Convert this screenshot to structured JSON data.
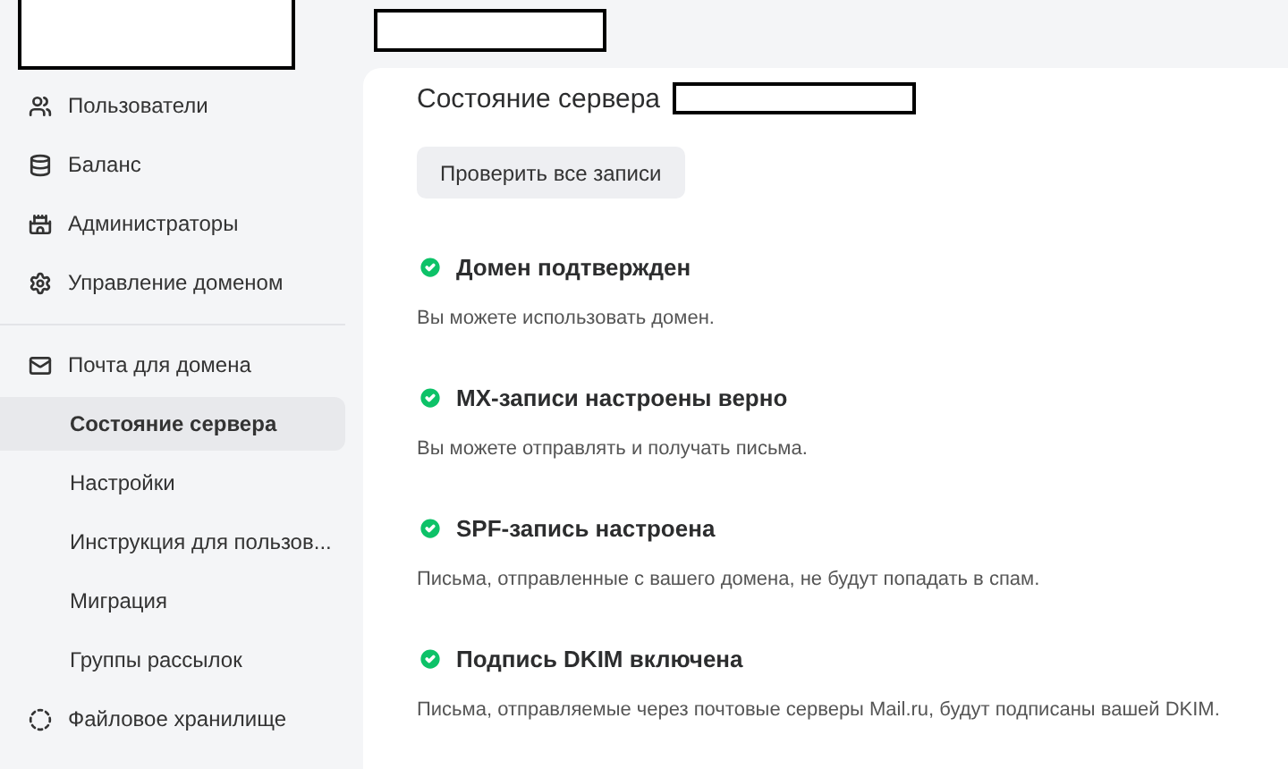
{
  "sidebar": {
    "sections": [
      {
        "items": [
          {
            "label": "Пользователи",
            "selected": false
          },
          {
            "label": "Баланс",
            "selected": false
          },
          {
            "label": "Администраторы",
            "selected": false
          },
          {
            "label": "Управление доменом",
            "selected": false
          }
        ]
      },
      {
        "items": [
          {
            "label": "Почта для домена",
            "selected": false,
            "children": [
              {
                "label": "Состояние сервера",
                "selected": true
              },
              {
                "label": "Настройки",
                "selected": false
              },
              {
                "label": "Инструкция для пользов...",
                "selected": false
              },
              {
                "label": "Миграция",
                "selected": false
              },
              {
                "label": "Группы рассылок",
                "selected": false
              }
            ]
          },
          {
            "label": "Файловое хранилище",
            "selected": false
          }
        ]
      }
    ]
  },
  "main": {
    "title": "Состояние сервера",
    "button": "Проверить все записи",
    "checks": [
      {
        "title": "Домен подтвержден",
        "passed": true,
        "text": "Вы можете использовать домен."
      },
      {
        "title": "MX-записи настроены верно",
        "passed": true,
        "text": "Вы можете отправлять и получать письма."
      },
      {
        "title": "SPF-запись настроена",
        "passed": true,
        "text": "Письма, отправленные с вашего домена, не будут попадать в спам."
      },
      {
        "title": "Подпись DKIM включена",
        "passed": true,
        "text": "Письма, отправляемые через почтовые серверы Mail.ru, будут подписаны вашей DKIM."
      }
    ]
  }
}
